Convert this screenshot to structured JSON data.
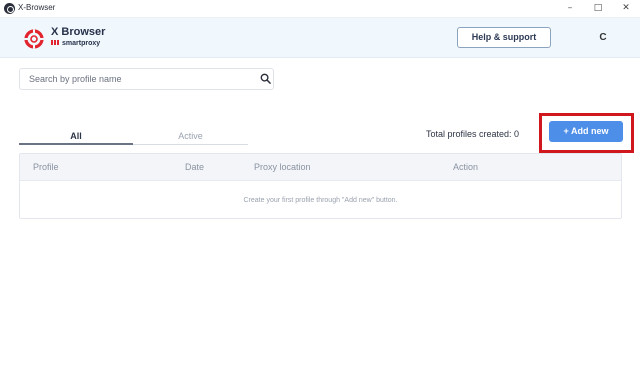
{
  "window": {
    "title": "X-Browser",
    "icon": "xbrowser-app-icon",
    "controls": [
      "minimize-icon",
      "maximize-icon",
      "close-icon"
    ]
  },
  "header": {
    "brand_name": "X Browser",
    "brand_sub": "smartproxy",
    "logo": "lifebuoy-logo-icon",
    "help_label": "Help & support",
    "avatar_letter": "C"
  },
  "search": {
    "placeholder": "Search by profile name",
    "value": "",
    "icon": "search-icon"
  },
  "tabs": [
    {
      "label": "All",
      "selected": true
    },
    {
      "label": "Active",
      "selected": false
    }
  ],
  "total_label": "Total profiles created: 0",
  "add_new_label": "+ Add new",
  "table": {
    "columns": [
      "Profile",
      "Date",
      "Proxy location",
      "Action"
    ],
    "rows": [],
    "empty_message": "Create your first profile through \"Add new\" button."
  },
  "colors": {
    "accent": "#4d8fe8",
    "highlight": "#d0171d",
    "brand_red": "#e2242f",
    "header_bg": "#f1f8fd"
  }
}
